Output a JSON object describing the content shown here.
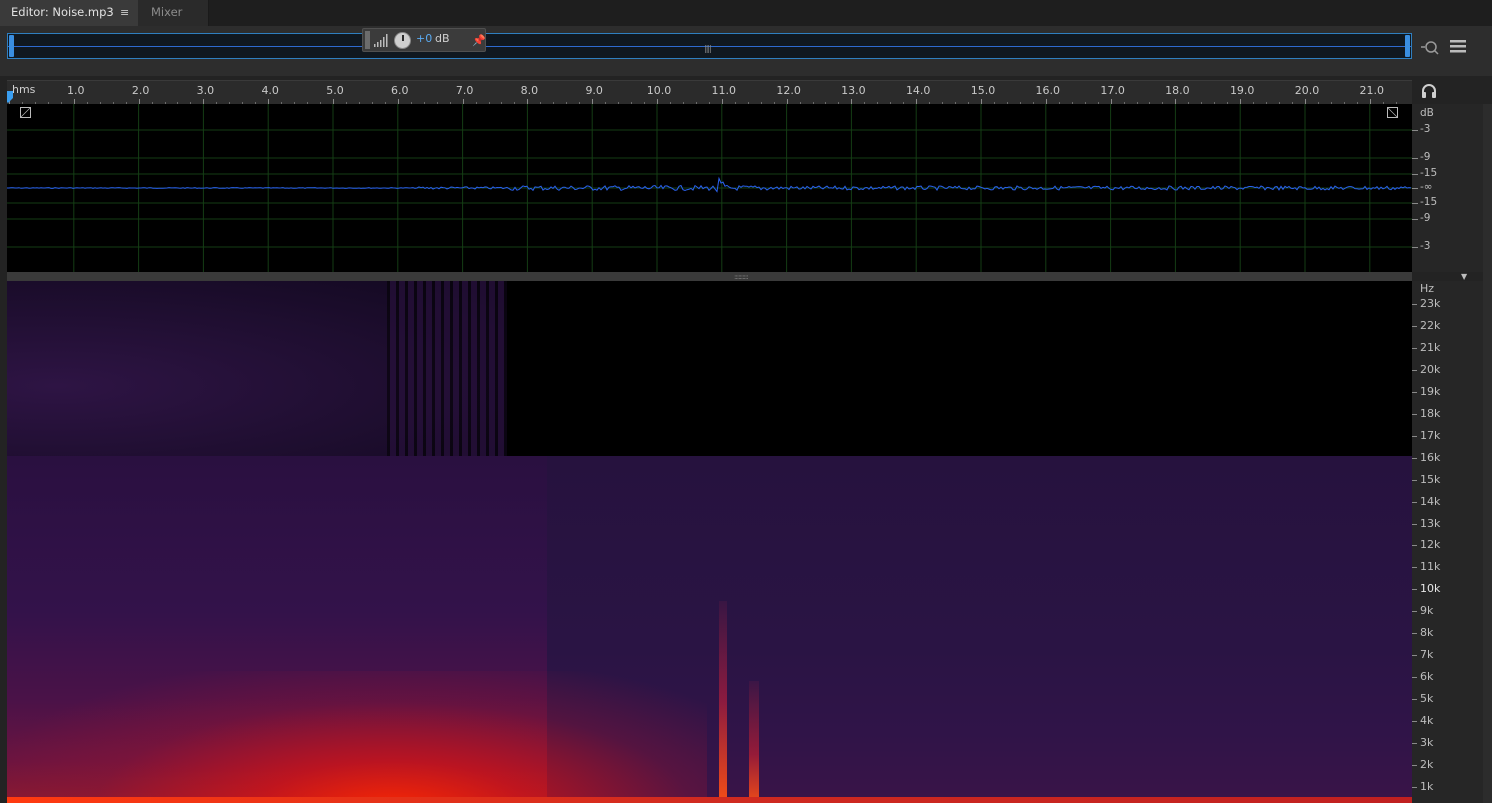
{
  "tabs": [
    {
      "label": "Editor: Noise.mp3",
      "active": true
    },
    {
      "label": "Mixer",
      "active": false
    }
  ],
  "tab_menu_glyph": "≡",
  "hud": {
    "gain_value": "+0",
    "gain_unit": "dB"
  },
  "ruler": {
    "unit_label": "hms",
    "ticks": [
      "1.0",
      "2.0",
      "3.0",
      "4.0",
      "5.0",
      "6.0",
      "7.0",
      "8.0",
      "9.0",
      "10.0",
      "11.0",
      "12.0",
      "13.0",
      "14.0",
      "15.0",
      "16.0",
      "17.0",
      "18.0",
      "19.0",
      "20.0",
      "21.0"
    ]
  },
  "db_scale": {
    "unit": "dB",
    "labels": [
      "-3",
      "-9",
      "-15",
      "-∞",
      "-15",
      "-9",
      "-3"
    ]
  },
  "hz_scale": {
    "unit": "Hz",
    "labels": [
      "23k",
      "22k",
      "21k",
      "20k",
      "19k",
      "18k",
      "17k",
      "16k",
      "15k",
      "14k",
      "13k",
      "12k",
      "11k",
      "10k",
      "9k",
      "8k",
      "7k",
      "6k",
      "5k",
      "4k",
      "3k",
      "2k",
      "1k"
    ]
  },
  "colors": {
    "waveform": "#2a62f0",
    "accent": "#2f9ef0",
    "spectral_base": "#1e0d32",
    "spectral_hot": "#ff2a00"
  },
  "icons": {
    "tab_menu": "hamburger-icon",
    "volume": "volume-bars-icon",
    "knob": "gain-knob-icon",
    "pin": "pin-icon",
    "zoom": "zoom-icon",
    "view_list": "list-icon",
    "headphones": "headphones-icon",
    "playhead": "playhead-marker-icon"
  }
}
